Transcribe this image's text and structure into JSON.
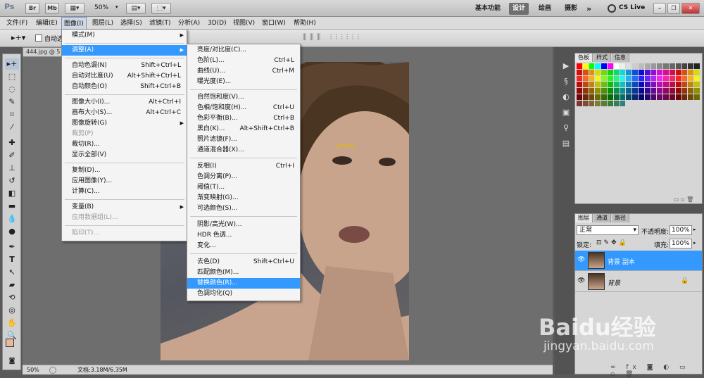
{
  "title_bar": {
    "app_logo": "Ps",
    "buttons": [
      "Br",
      "Mb"
    ],
    "zoom": "50%",
    "workspaces": [
      "基本功能",
      "设计",
      "绘画",
      "摄影"
    ],
    "active_workspace": "设计",
    "more": "»",
    "cslive": "CS Live"
  },
  "menubar": [
    "文件(F)",
    "编辑(E)",
    "图像(I)",
    "图层(L)",
    "选择(S)",
    "滤镜(T)",
    "分析(A)",
    "3D(D)",
    "视图(V)",
    "窗口(W)",
    "帮助(H)"
  ],
  "options_bar": {
    "auto_select_label": "自动选"
  },
  "document": {
    "tab": "444.jpg @ 5",
    "status_zoom": "50%",
    "status_doc": "文档:3.18M/6.35M"
  },
  "image_menu": [
    {
      "label": "模式(M)",
      "submenu": true
    },
    {
      "label": "调整(A)",
      "submenu": true,
      "highlight": true
    },
    {
      "label": "自动色调(N)",
      "shortcut": "Shift+Ctrl+L"
    },
    {
      "label": "自动对比度(U)",
      "shortcut": "Alt+Shift+Ctrl+L"
    },
    {
      "label": "自动颜色(O)",
      "shortcut": "Shift+Ctrl+B"
    },
    {
      "label": "图像大小(I)...",
      "shortcut": "Alt+Ctrl+I"
    },
    {
      "label": "画布大小(S)...",
      "shortcut": "Alt+Ctrl+C"
    },
    {
      "label": "图像旋转(G)",
      "submenu": true
    },
    {
      "label": "裁剪(P)",
      "disabled": true
    },
    {
      "label": "裁切(R)..."
    },
    {
      "label": "显示全部(V)"
    },
    {
      "label": "复制(D)..."
    },
    {
      "label": "应用图像(Y)..."
    },
    {
      "label": "计算(C)..."
    },
    {
      "label": "变量(B)",
      "submenu": true
    },
    {
      "label": "应用数据组(L)...",
      "disabled": true
    },
    {
      "label": "陷印(T)...",
      "disabled": true
    }
  ],
  "adjust_menu": [
    {
      "label": "亮度/对比度(C)..."
    },
    {
      "label": "色阶(L)...",
      "shortcut": "Ctrl+L"
    },
    {
      "label": "曲线(U)...",
      "shortcut": "Ctrl+M"
    },
    {
      "label": "曝光度(E)..."
    },
    {
      "label": "自然饱和度(V)..."
    },
    {
      "label": "色相/饱和度(H)...",
      "shortcut": "Ctrl+U"
    },
    {
      "label": "色彩平衡(B)...",
      "shortcut": "Ctrl+B"
    },
    {
      "label": "黑白(K)...",
      "shortcut": "Alt+Shift+Ctrl+B"
    },
    {
      "label": "照片滤镜(F)..."
    },
    {
      "label": "通道混合器(X)..."
    },
    {
      "label": "反相(I)",
      "shortcut": "Ctrl+I"
    },
    {
      "label": "色调分离(P)..."
    },
    {
      "label": "阈值(T)..."
    },
    {
      "label": "渐变映射(G)..."
    },
    {
      "label": "可选颜色(S)..."
    },
    {
      "label": "阴影/高光(W)..."
    },
    {
      "label": "HDR 色调..."
    },
    {
      "label": "变化..."
    },
    {
      "label": "去色(D)",
      "shortcut": "Shift+Ctrl+U"
    },
    {
      "label": "匹配颜色(M)..."
    },
    {
      "label": "替换颜色(R)...",
      "highlight": true
    },
    {
      "label": "色调均化(Q)"
    }
  ],
  "swatches_panel": {
    "tabs": [
      "色板",
      "样式",
      "信息"
    ]
  },
  "layers_panel": {
    "tabs": [
      "图层",
      "通道",
      "路径"
    ],
    "blend_mode": "正常",
    "opacity_label": "不透明度:",
    "opacity": "100%",
    "lock_label": "锁定:",
    "fill_label": "填充:",
    "fill": "100%",
    "layers": [
      {
        "name": "背景 副本",
        "selected": true
      },
      {
        "name": "背景",
        "selected": false,
        "locked": true
      }
    ]
  },
  "watermark": {
    "brand": "Baidu经验",
    "url": "jingyan.baidu.com"
  },
  "colors": {
    "highlight": "#3399ff",
    "fg_swatch": "#e8b89a",
    "bg_swatch": "#111111"
  }
}
